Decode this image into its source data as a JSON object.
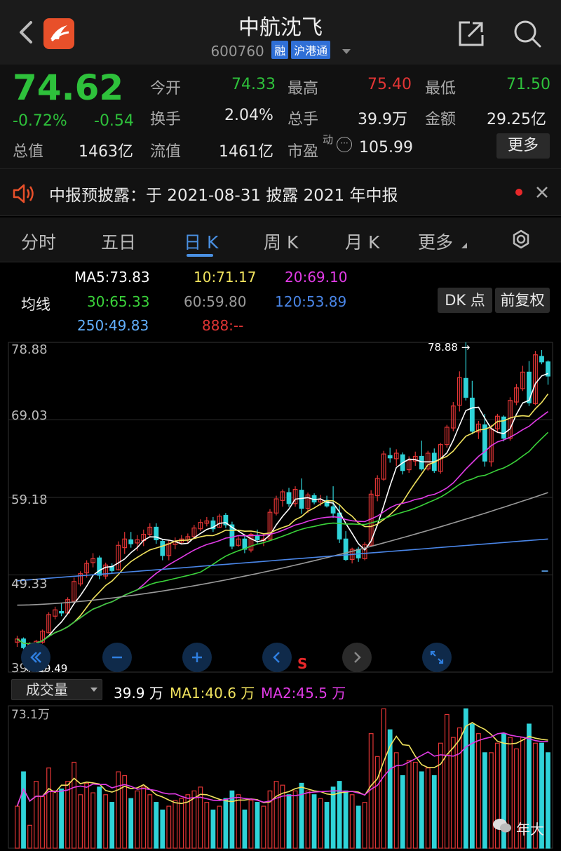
{
  "header": {
    "title": "中航沈飞",
    "code": "600760",
    "tags": [
      "融",
      "沪港通"
    ]
  },
  "quote": {
    "price": "74.62",
    "change_pct": "-0.72%",
    "change": "-0.54",
    "rows": [
      [
        {
          "label": "今开",
          "value": "74.33"
        },
        {
          "label": "最高",
          "value": "75.40"
        },
        {
          "label": "最低",
          "value": "71.50"
        }
      ],
      [
        {
          "label": "换手",
          "value": "2.04%"
        },
        {
          "label": "总手",
          "value": "39.9万"
        },
        {
          "label": "金额",
          "value": "29.25亿"
        }
      ],
      [
        {
          "label": "流值",
          "value": "1461亿"
        },
        {
          "label": "市盈",
          "value": "105.99",
          "sup": "动"
        }
      ]
    ],
    "total_value_label": "总值",
    "total_value": "1463亿",
    "more_label": "更多"
  },
  "notice": {
    "text": "中报预披露：于 2021-08-31 披露 2021 年中报"
  },
  "tabs": [
    {
      "label": "分时"
    },
    {
      "label": "五日"
    },
    {
      "label": "日 K"
    },
    {
      "label": "周 K"
    },
    {
      "label": "月 K"
    },
    {
      "label": "更多"
    }
  ],
  "ma_panel": {
    "title": "均线",
    "items": [
      "MA5:73.83",
      "10:71.17",
      "20:69.10",
      "30:65.33",
      "60:59.80",
      "120:53.89",
      "250:49.83",
      "888:--"
    ],
    "dk_label": "DK 点",
    "adjust_label": "前复权"
  },
  "price_axis": {
    "labels": [
      "78.88",
      "69.03",
      "59.18",
      "49.33",
      "39.49"
    ],
    "high_marker": "78.88",
    "low_marker": "39.49"
  },
  "nav": {
    "s_label": "S"
  },
  "volume": {
    "selector": "成交量",
    "current": "39.9 万",
    "ma1": "MA1:40.6 万",
    "ma2": "MA2:45.5 万",
    "axis_max": "73.1万"
  },
  "watermark": "年大",
  "colors": {
    "up": "#e23535",
    "down": "#2ec13b",
    "candle_down": "#2fd3d8",
    "ma5": "#ffffff",
    "ma10": "#f1e35e",
    "ma20": "#e13be6",
    "ma30": "#3ad23a",
    "ma60": "#9a9a9a",
    "ma120": "#4a86e8",
    "ma250": "#62b0ff",
    "ma888": "#e23535"
  },
  "chart_data": {
    "type": "candlestick",
    "y_range": [
      39.49,
      78.88
    ],
    "candles": [
      [
        40.8,
        41.6,
        40.2,
        41.2
      ],
      [
        41.2,
        41.4,
        39.9,
        40.1
      ],
      [
        40.1,
        40.8,
        39.5,
        40.5
      ],
      [
        40.4,
        41.1,
        40.0,
        40.9
      ],
      [
        40.8,
        42.4,
        40.6,
        42.2
      ],
      [
        42.0,
        44.6,
        41.9,
        44.3
      ],
      [
        44.1,
        45.3,
        43.7,
        44.9
      ],
      [
        44.7,
        45.8,
        44.1,
        44.5
      ],
      [
        44.5,
        46.5,
        44.4,
        46.2
      ],
      [
        46.0,
        49.0,
        45.8,
        48.5
      ],
      [
        48.2,
        49.8,
        47.9,
        49.5
      ],
      [
        49.6,
        51.2,
        49.0,
        50.8
      ],
      [
        50.9,
        52.1,
        50.3,
        51.4
      ],
      [
        51.5,
        51.8,
        48.8,
        49.3
      ],
      [
        49.2,
        50.9,
        48.8,
        50.6
      ],
      [
        50.4,
        50.8,
        49.5,
        49.9
      ],
      [
        50.0,
        53.6,
        49.9,
        53.1
      ],
      [
        52.8,
        54.8,
        52.0,
        53.9
      ],
      [
        53.8,
        54.8,
        52.8,
        53.3
      ],
      [
        53.4,
        54.4,
        52.4,
        53.8
      ],
      [
        53.7,
        55.1,
        53.0,
        54.5
      ],
      [
        54.5,
        55.9,
        54.1,
        55.4
      ],
      [
        55.4,
        55.9,
        53.3,
        53.8
      ],
      [
        53.6,
        53.8,
        51.2,
        51.8
      ],
      [
        51.8,
        53.7,
        51.2,
        53.3
      ],
      [
        53.2,
        54.1,
        52.6,
        53.6
      ],
      [
        53.5,
        54.4,
        53.2,
        53.9
      ],
      [
        53.8,
        54.6,
        53.4,
        54.2
      ],
      [
        54.2,
        55.7,
        53.9,
        55.3
      ],
      [
        55.2,
        56.4,
        54.9,
        56.0
      ],
      [
        55.9,
        56.7,
        55.5,
        56.2
      ],
      [
        56.2,
        56.7,
        54.8,
        55.2
      ],
      [
        55.4,
        57.1,
        55.3,
        56.8
      ],
      [
        56.9,
        57.2,
        55.3,
        55.7
      ],
      [
        55.7,
        56.1,
        52.6,
        53.0
      ],
      [
        53.1,
        54.3,
        52.9,
        53.9
      ],
      [
        53.9,
        54.3,
        52.1,
        52.6
      ],
      [
        52.5,
        54.7,
        52.2,
        54.5
      ],
      [
        54.3,
        55.1,
        53.3,
        53.8
      ],
      [
        53.7,
        54.6,
        53.0,
        53.9
      ],
      [
        53.9,
        57.7,
        53.8,
        57.3
      ],
      [
        57.2,
        59.4,
        56.9,
        59.0
      ],
      [
        58.8,
        60.2,
        58.0,
        59.9
      ],
      [
        59.8,
        60.4,
        58.0,
        58.4
      ],
      [
        58.4,
        60.6,
        58.0,
        60.2
      ],
      [
        60.1,
        61.6,
        57.1,
        57.8
      ],
      [
        57.8,
        59.8,
        57.2,
        59.5
      ],
      [
        59.4,
        59.7,
        58.3,
        58.6
      ],
      [
        58.6,
        59.5,
        58.1,
        58.9
      ],
      [
        58.8,
        59.4,
        57.9,
        58.1
      ],
      [
        58.0,
        60.6,
        56.6,
        57.2
      ],
      [
        57.2,
        58.3,
        53.4,
        53.9
      ],
      [
        53.9,
        54.9,
        51.1,
        51.3
      ],
      [
        51.3,
        52.8,
        50.8,
        52.6
      ],
      [
        52.6,
        52.9,
        51.0,
        51.5
      ],
      [
        51.4,
        53.5,
        51.2,
        53.2
      ],
      [
        53.1,
        60.1,
        52.9,
        59.6
      ],
      [
        59.4,
        62.0,
        58.7,
        61.6
      ],
      [
        61.5,
        65.1,
        61.3,
        64.7
      ],
      [
        64.5,
        65.5,
        63.6,
        64.2
      ],
      [
        64.1,
        65.3,
        63.2,
        64.8
      ],
      [
        64.6,
        64.9,
        62.1,
        62.6
      ],
      [
        62.7,
        64.4,
        62.3,
        63.9
      ],
      [
        63.8,
        65.0,
        63.2,
        64.4
      ],
      [
        64.4,
        66.4,
        62.6,
        62.8
      ],
      [
        62.8,
        65.1,
        62.6,
        64.8
      ],
      [
        64.8,
        65.4,
        62.3,
        62.6
      ],
      [
        62.5,
        66.1,
        62.2,
        65.9
      ],
      [
        65.9,
        68.4,
        65.5,
        68.1
      ],
      [
        68.0,
        71.3,
        67.6,
        70.8
      ],
      [
        70.9,
        75.2,
        70.1,
        74.4
      ],
      [
        74.3,
        78.9,
        71.5,
        71.9
      ],
      [
        71.8,
        74.0,
        67.2,
        67.6
      ],
      [
        67.5,
        68.9,
        66.6,
        68.5
      ],
      [
        68.4,
        69.8,
        63.1,
        63.8
      ],
      [
        63.7,
        68.4,
        63.1,
        67.9
      ],
      [
        67.9,
        69.8,
        67.4,
        69.5
      ],
      [
        69.4,
        69.6,
        66.3,
        66.7
      ],
      [
        66.7,
        71.9,
        66.4,
        71.5
      ],
      [
        71.3,
        73.6,
        70.9,
        73.1
      ],
      [
        73.0,
        75.9,
        72.7,
        75.1
      ],
      [
        75.1,
        76.5,
        70.8,
        71.2
      ],
      [
        71.1,
        77.8,
        70.9,
        77.3
      ],
      [
        77.1,
        77.9,
        76.1,
        76.4
      ],
      [
        76.4,
        76.6,
        73.5,
        74.6
      ]
    ],
    "volume": [
      22,
      40,
      12,
      35,
      27,
      42,
      30,
      31,
      35,
      45,
      28,
      34,
      29,
      32,
      28,
      24,
      40,
      38,
      26,
      30,
      32,
      28,
      24,
      20,
      22,
      25,
      26,
      28,
      30,
      32,
      24,
      20,
      22,
      26,
      30,
      28,
      20,
      25,
      24,
      22,
      30,
      35,
      33,
      28,
      30,
      34,
      30,
      28,
      26,
      24,
      32,
      35,
      30,
      28,
      22,
      24,
      60,
      48,
      73,
      62,
      50,
      38,
      46,
      45,
      40,
      42,
      38,
      55,
      70,
      58,
      63,
      73,
      65,
      60,
      50,
      50,
      55,
      60,
      58,
      52,
      58,
      65,
      55,
      55,
      50
    ]
  }
}
